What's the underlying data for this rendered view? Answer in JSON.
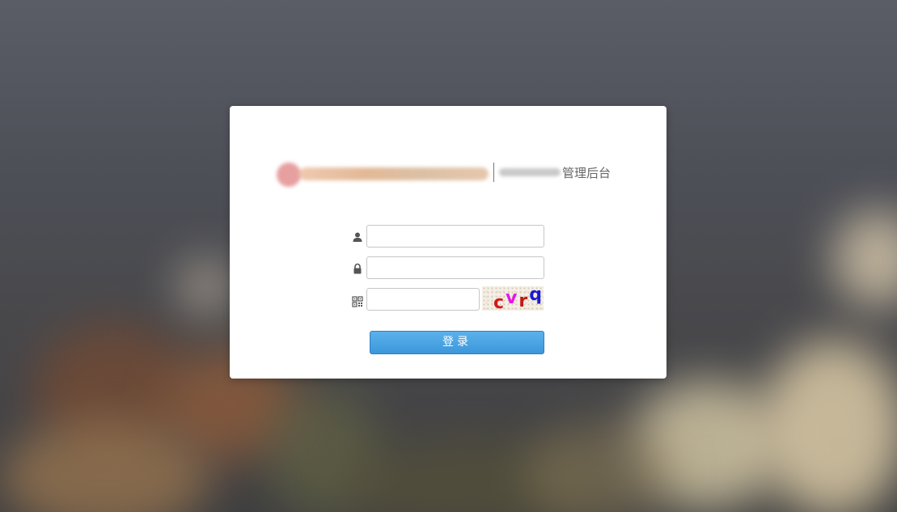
{
  "background": {
    "base_colors": [
      "#5a5d66",
      "#4a4a4e",
      "#3f3f40"
    ],
    "accent_blurs": [
      "#7a5238",
      "#9c6a44",
      "#d8c8a6",
      "#e9d6ae"
    ]
  },
  "brand": {
    "logo_icon": "logo-blurred",
    "title": "管理后台"
  },
  "form": {
    "username": {
      "icon": "user-icon",
      "value": "",
      "placeholder": ""
    },
    "password": {
      "icon": "lock-icon",
      "value": "",
      "placeholder": ""
    },
    "captcha": {
      "icon": "qrcode-icon",
      "value": "",
      "placeholder": "",
      "image_chars": [
        {
          "ch": "c",
          "color": "#d21a1a"
        },
        {
          "ch": "v",
          "color": "#e21ae2"
        },
        {
          "ch": "r",
          "color": "#c21a1a"
        },
        {
          "ch": "q",
          "color": "#1a1ad2"
        }
      ]
    },
    "submit_label": "登录"
  },
  "colors": {
    "button_top": "#5bb1ec",
    "button_bottom": "#3c97da",
    "card": "#ffffff"
  }
}
